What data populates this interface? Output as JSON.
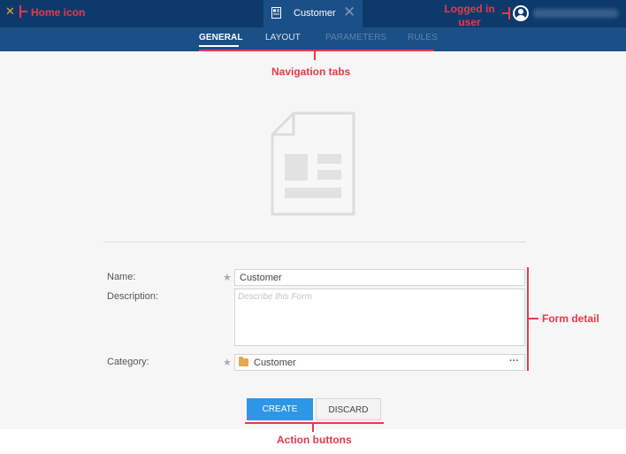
{
  "topbar": {
    "document_tab": {
      "title": "Customer",
      "close_glyph": "✕",
      "icon": "form-document-icon"
    },
    "home_icon": "home-icon",
    "user_icon": "user-avatar-icon",
    "colors": {
      "bar": "#0d3a6b",
      "tab": "#1a4f87"
    }
  },
  "nav": {
    "tabs": [
      {
        "label": "GENERAL",
        "state": "active"
      },
      {
        "label": "LAYOUT",
        "state": "enabled"
      },
      {
        "label": "PARAMETERS",
        "state": "disabled"
      },
      {
        "label": "RULES",
        "state": "disabled"
      }
    ]
  },
  "form": {
    "name_label": "Name:",
    "name_value": "Customer",
    "description_label": "Description:",
    "description_placeholder": "Describe this Form",
    "category_label": "Category:",
    "category_value": "Customer",
    "more_glyph": "···",
    "required_glyph": "★"
  },
  "actions": {
    "create_label": "CREATE",
    "discard_label": "DISCARD",
    "accent": "#2e96e6"
  },
  "annotations": {
    "home": "Home icon",
    "user": "Logged in user",
    "nav": "Navigation tabs",
    "form": "Form detail",
    "actions": "Action buttons",
    "color": "#e8394a"
  }
}
